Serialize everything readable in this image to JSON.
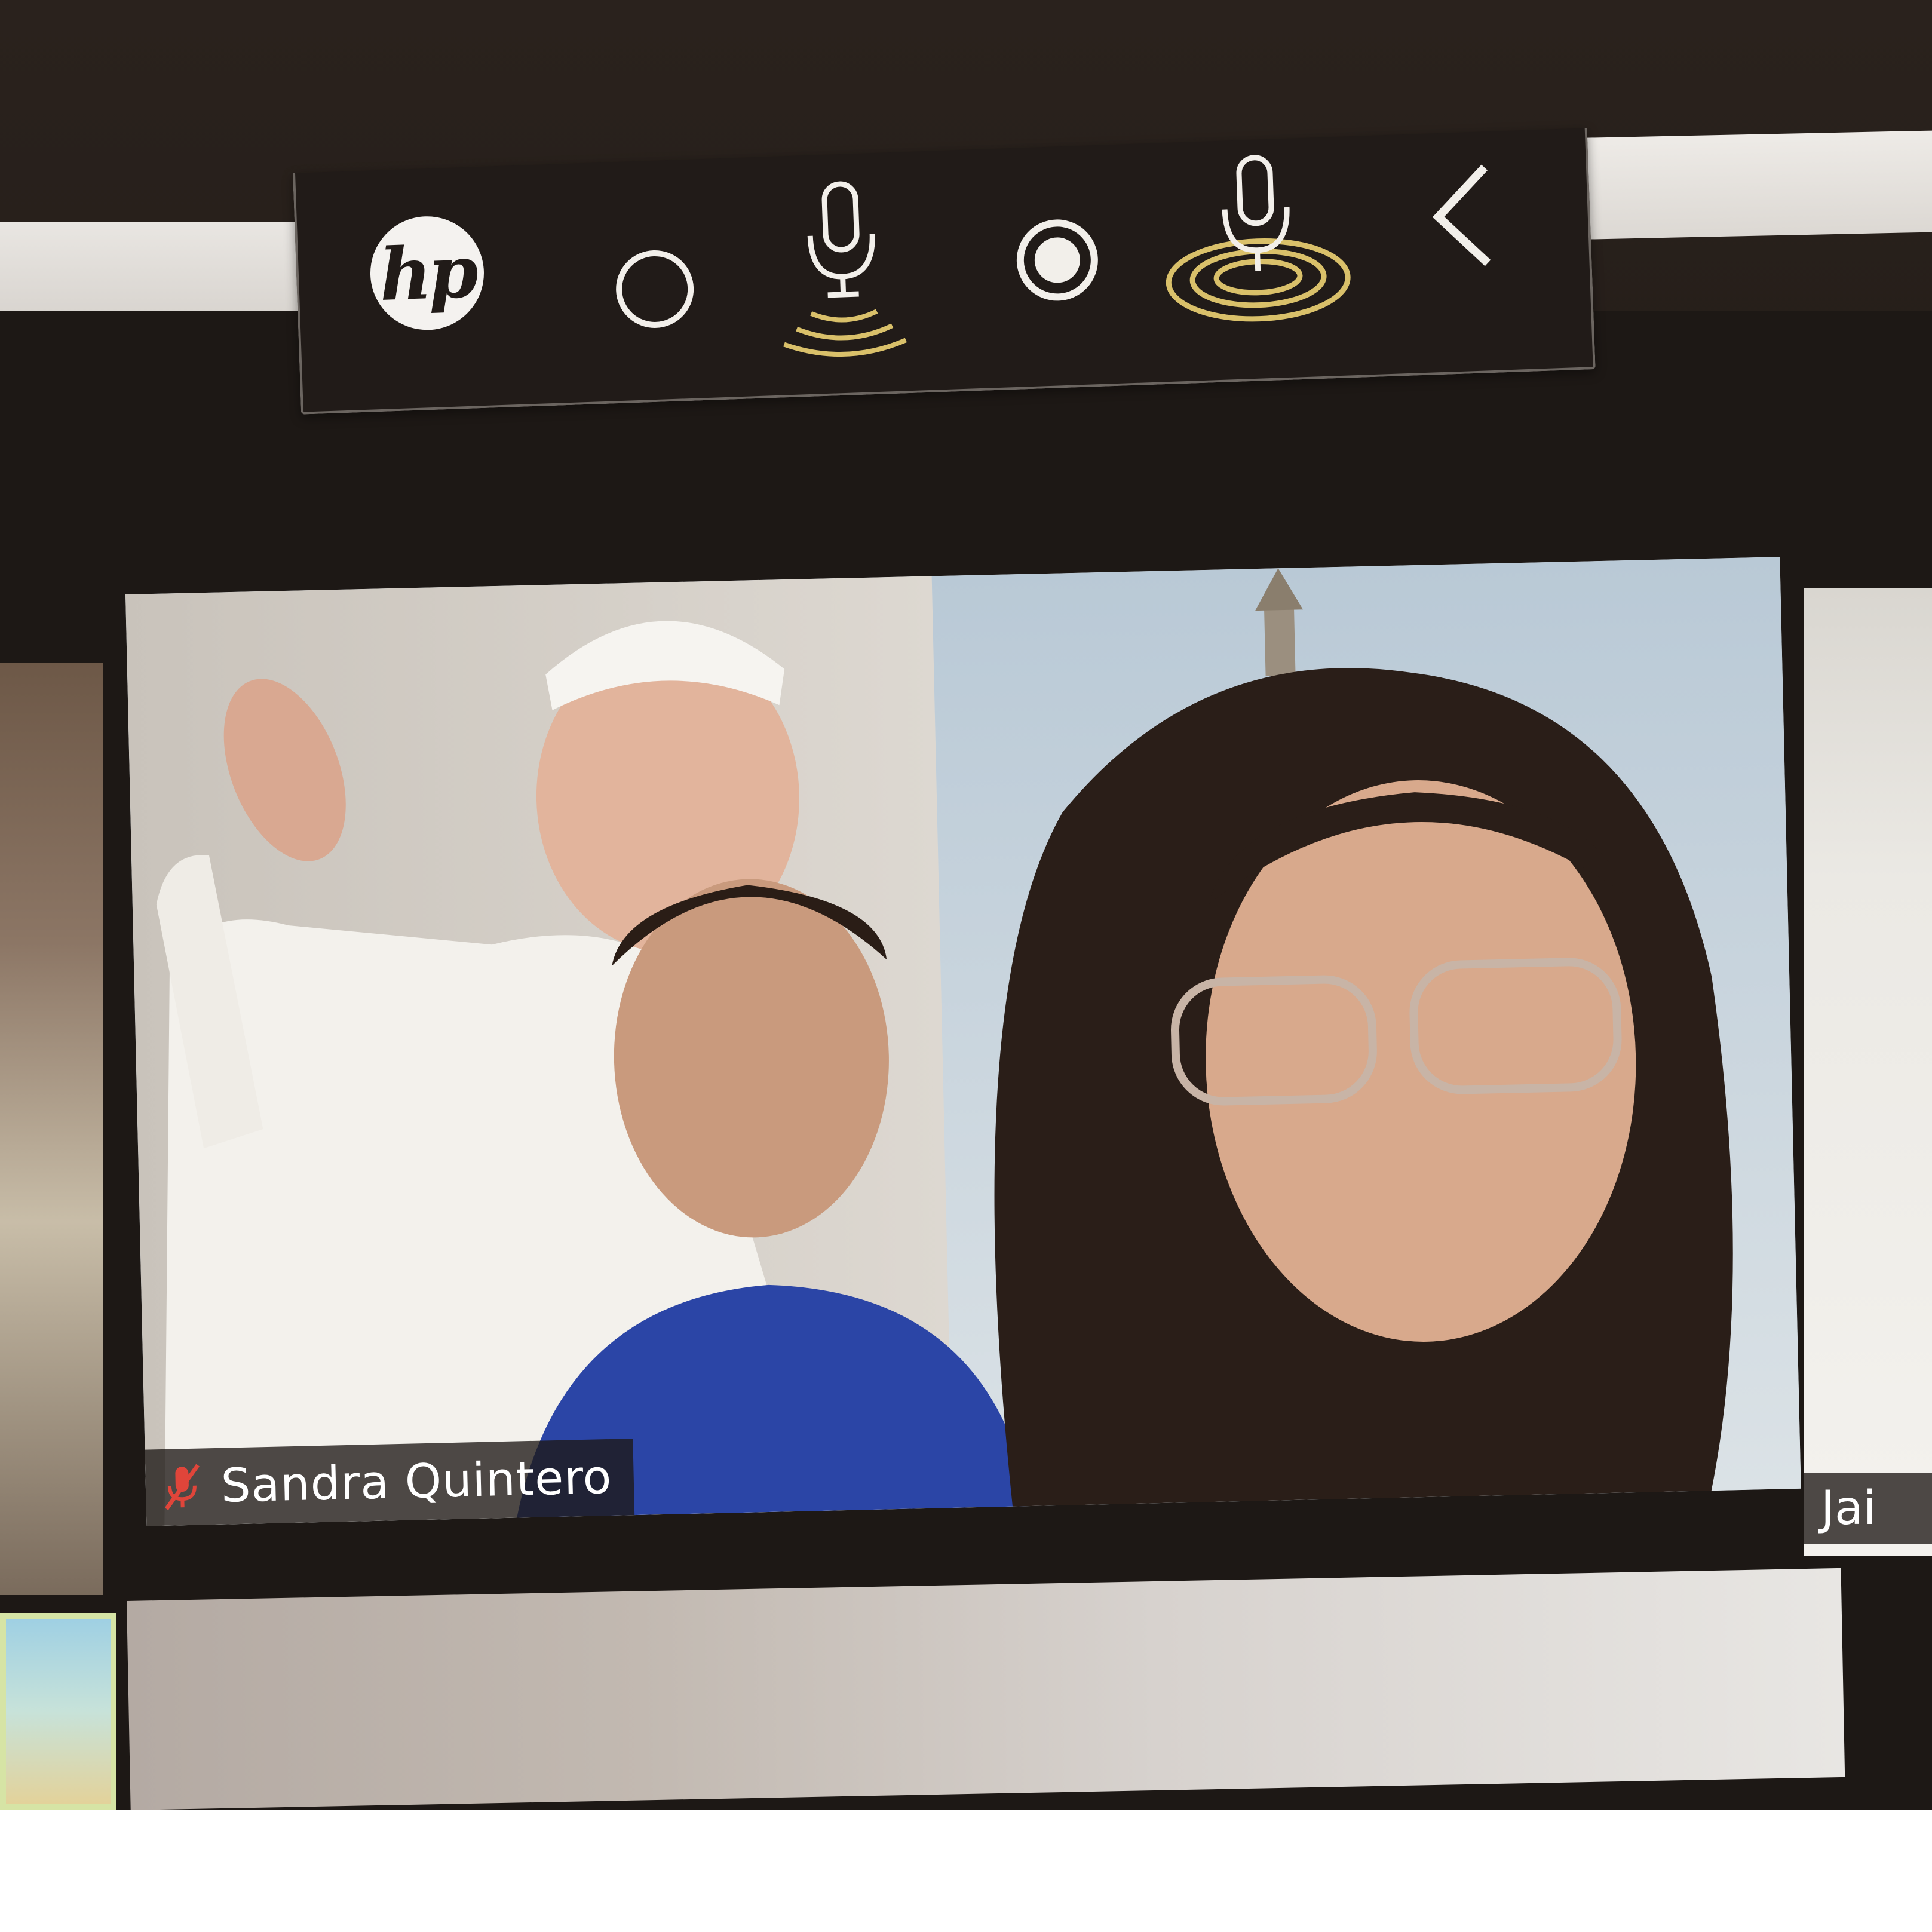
{
  "control_bar": {
    "brand_logo": "hp",
    "icons": [
      "hp-logo-icon",
      "record-off-icon",
      "microphone-icon",
      "record-on-icon",
      "microphone-active-icon",
      "chevron-left-icon"
    ],
    "accent_color": "#d9c06a"
  },
  "main_participant": {
    "name": "Sandra Quintero",
    "muted": true,
    "muted_icon": "mic-muted-icon",
    "muted_color": "#e0453a"
  },
  "right_participant": {
    "name": "Jai"
  }
}
